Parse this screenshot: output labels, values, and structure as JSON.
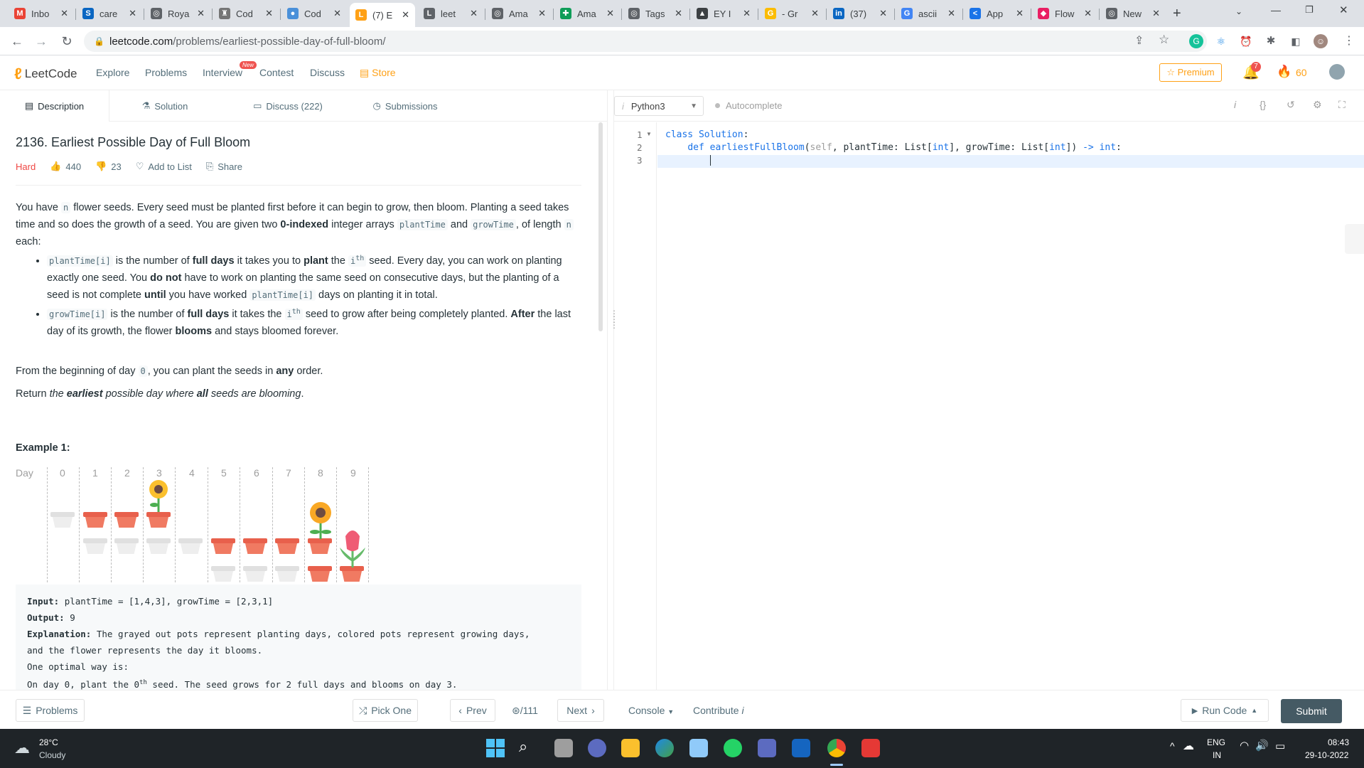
{
  "browser": {
    "tabs": [
      {
        "label": "Inbo",
        "fav_color": "#ea4335",
        "fav_char": "M"
      },
      {
        "label": "care",
        "fav_color": "#0a66c2",
        "fav_char": "S"
      },
      {
        "label": "Roya",
        "fav_color": "#5f6368",
        "fav_char": "◎"
      },
      {
        "label": "Cod",
        "fav_color": "#757575",
        "fav_char": "♜"
      },
      {
        "label": "Cod",
        "fav_color": "#4a90d9",
        "fav_char": "●"
      },
      {
        "label": "(7) E",
        "fav_color": "#ffa116",
        "fav_char": "L"
      },
      {
        "label": "leet",
        "fav_color": "#5f6368",
        "fav_char": "L"
      },
      {
        "label": "Ama",
        "fav_color": "#5f6368",
        "fav_char": "◎"
      },
      {
        "label": "Ama",
        "fav_color": "#0f9d58",
        "fav_char": "✚"
      },
      {
        "label": "Tags",
        "fav_color": "#5f6368",
        "fav_char": "◎"
      },
      {
        "label": "EY I",
        "fav_color": "#3c4043",
        "fav_char": "▲"
      },
      {
        "label": "- Gr",
        "fav_color": "#fbbc04",
        "fav_char": "G"
      },
      {
        "label": "(37)",
        "fav_color": "#0a66c2",
        "fav_char": "in"
      },
      {
        "label": "ascii",
        "fav_color": "#4285f4",
        "fav_char": "G"
      },
      {
        "label": "App",
        "fav_color": "#1a73e8",
        "fav_char": "<"
      },
      {
        "label": "Flow",
        "fav_color": "#e91e63",
        "fav_char": "◆"
      },
      {
        "label": "New",
        "fav_color": "#5f6368",
        "fav_char": "◎"
      }
    ],
    "url_host": "leetcode.com",
    "url_path": "/problems/earliest-possible-day-of-full-bloom/"
  },
  "lc": {
    "logo": "LeetCode",
    "nav": [
      "Explore",
      "Problems",
      "Interview",
      "Contest",
      "Discuss",
      "Store"
    ],
    "new_badge": "New",
    "premium": "Premium",
    "notif_count": "7",
    "streak": "60"
  },
  "left_tabs": [
    "Description",
    "Solution",
    "Discuss (222)",
    "Submissions"
  ],
  "problem": {
    "title": "2136. Earliest Possible Day of Full Bloom",
    "difficulty": "Hard",
    "likes": "440",
    "dislikes": "23",
    "add_to_list": "Add to List",
    "share": "Share",
    "example_title": "Example 1:",
    "day_label": "Day",
    "days": [
      "0",
      "1",
      "2",
      "3",
      "4",
      "5",
      "6",
      "7",
      "8",
      "9"
    ],
    "input_label": "Input:",
    "input_value": "plantTime = [1,4,3], growTime = [2,3,1]",
    "output_label": "Output:",
    "output_value": "9",
    "explanation_label": "Explanation:",
    "explanation_1": "The grayed out pots represent planting days, colored pots represent growing days,",
    "explanation_2": "and the flower represents the day it blooms.",
    "explanation_3": "One optimal way is:",
    "explanation_4a": "On day 0, plant the 0",
    "explanation_4sup": "th",
    "explanation_4b": " seed. The seed grows for 2 full days and blooms on day 3."
  },
  "editor": {
    "language": "Python3",
    "autocomplete": "Autocomplete",
    "line_numbers": [
      "1",
      "2",
      "3"
    ]
  },
  "bottom": {
    "problems": "Problems",
    "pick_one": "Pick One",
    "prev": "Prev",
    "counter": "/111",
    "next": "Next",
    "console": "Console",
    "contribute": "Contribute",
    "run_code": "Run Code",
    "submit": "Submit"
  },
  "taskbar": {
    "temp": "28°C",
    "weather": "Cloudy",
    "lang": "ENG",
    "region": "IN",
    "time": "08:43",
    "date": "29-10-2022"
  }
}
